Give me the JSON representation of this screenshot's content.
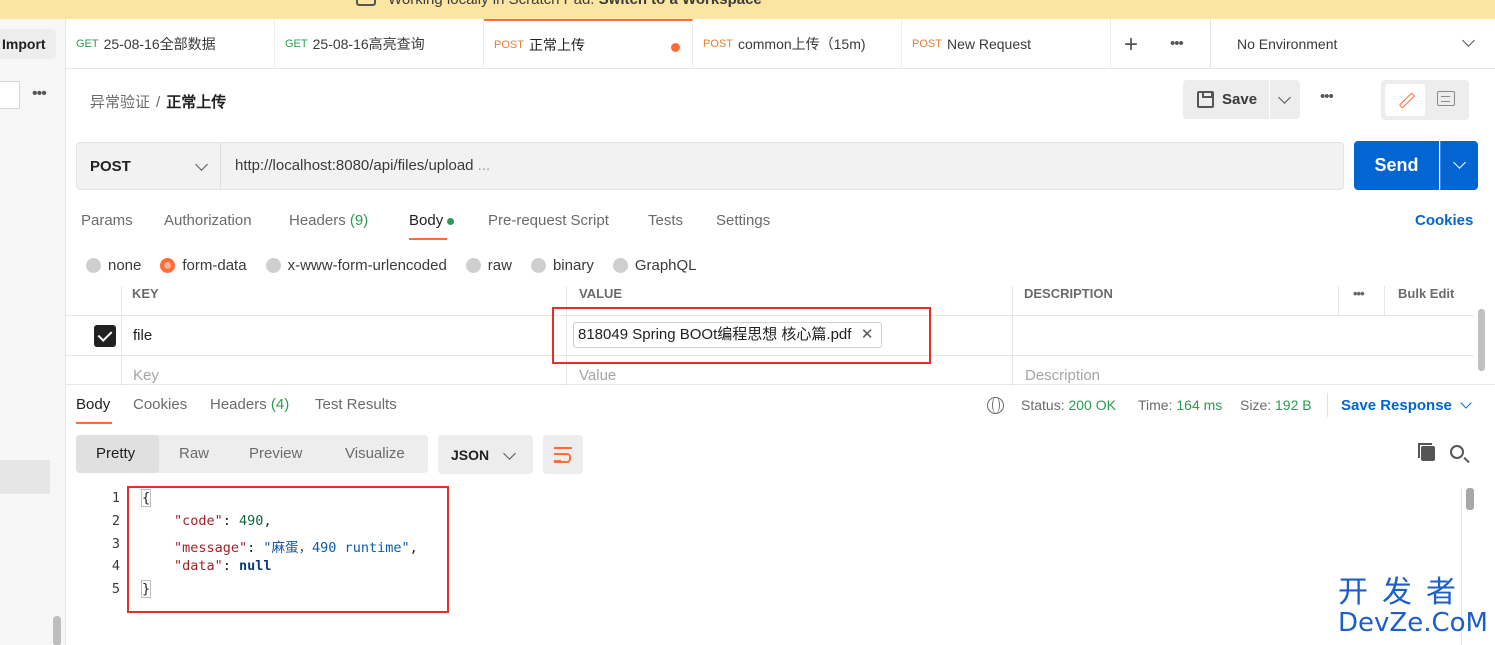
{
  "banner": {
    "text": "Working locally in Scratch Pad.",
    "link": "Switch to a Workspace"
  },
  "sidebar": {
    "import_label": "Import",
    "more_icon": "ellipsis-icon"
  },
  "tabs": [
    {
      "method": "GET",
      "label": "25-08-16全部数据"
    },
    {
      "method": "GET",
      "label": "25-08-16高亮查询"
    },
    {
      "method": "POST",
      "label": "正常上传",
      "unsaved": true
    },
    {
      "method": "POST",
      "label": "common上传（15m)"
    },
    {
      "method": "POST",
      "label": "New Request"
    }
  ],
  "environment": "No Environment",
  "breadcrumb": {
    "parent": "异常验证",
    "separator": "/",
    "current": "正常上传"
  },
  "toolbar": {
    "save_label": "Save"
  },
  "request": {
    "method": "POST",
    "url": "http://localhost:8080/api/files/upload",
    "url_ellipsis": "...",
    "send_label": "Send"
  },
  "request_tabs": {
    "params": "Params",
    "authorization": "Authorization",
    "headers": "Headers",
    "headers_count": "(9)",
    "body": "Body",
    "prerequest": "Pre-request Script",
    "tests": "Tests",
    "settings": "Settings",
    "cookies": "Cookies"
  },
  "body_types": {
    "none": "none",
    "form_data": "form-data",
    "urlencoded": "x-www-form-urlencoded",
    "raw": "raw",
    "binary": "binary",
    "graphql": "GraphQL",
    "selected": "form-data"
  },
  "form_table": {
    "headers": {
      "key": "KEY",
      "value": "VALUE",
      "description": "DESCRIPTION",
      "bulk_edit": "Bulk Edit"
    },
    "rows": [
      {
        "checked": true,
        "key": "file",
        "value": "818049 Spring BOOt编程思想 核心篇.pdf"
      }
    ],
    "placeholders": {
      "key": "Key",
      "value": "Value",
      "description": "Description"
    }
  },
  "response": {
    "tabs": {
      "body": "Body",
      "cookies": "Cookies",
      "headers": "Headers",
      "headers_count": "(4)",
      "tests": "Test Results"
    },
    "status_label": "Status:",
    "status_value": "200 OK",
    "time_label": "Time:",
    "time_value": "164 ms",
    "size_label": "Size:",
    "size_value": "192 B",
    "save_response": "Save Response",
    "views": {
      "pretty": "Pretty",
      "raw": "Raw",
      "preview": "Preview",
      "visualize": "Visualize"
    },
    "format": "JSON",
    "lines": [
      {
        "no": "1",
        "text": "{"
      },
      {
        "no": "2",
        "key": "\"code\"",
        "value": "490",
        "suffix": ","
      },
      {
        "no": "3",
        "key": "\"message\"",
        "value": "\"麻蛋，490 runtime\"",
        "suffix": ","
      },
      {
        "no": "4",
        "key": "\"data\"",
        "value": "null",
        "suffix": ""
      },
      {
        "no": "5",
        "text": "}"
      }
    ]
  },
  "watermark": {
    "top": "开发者",
    "bottom": "DevZe.CoM"
  }
}
